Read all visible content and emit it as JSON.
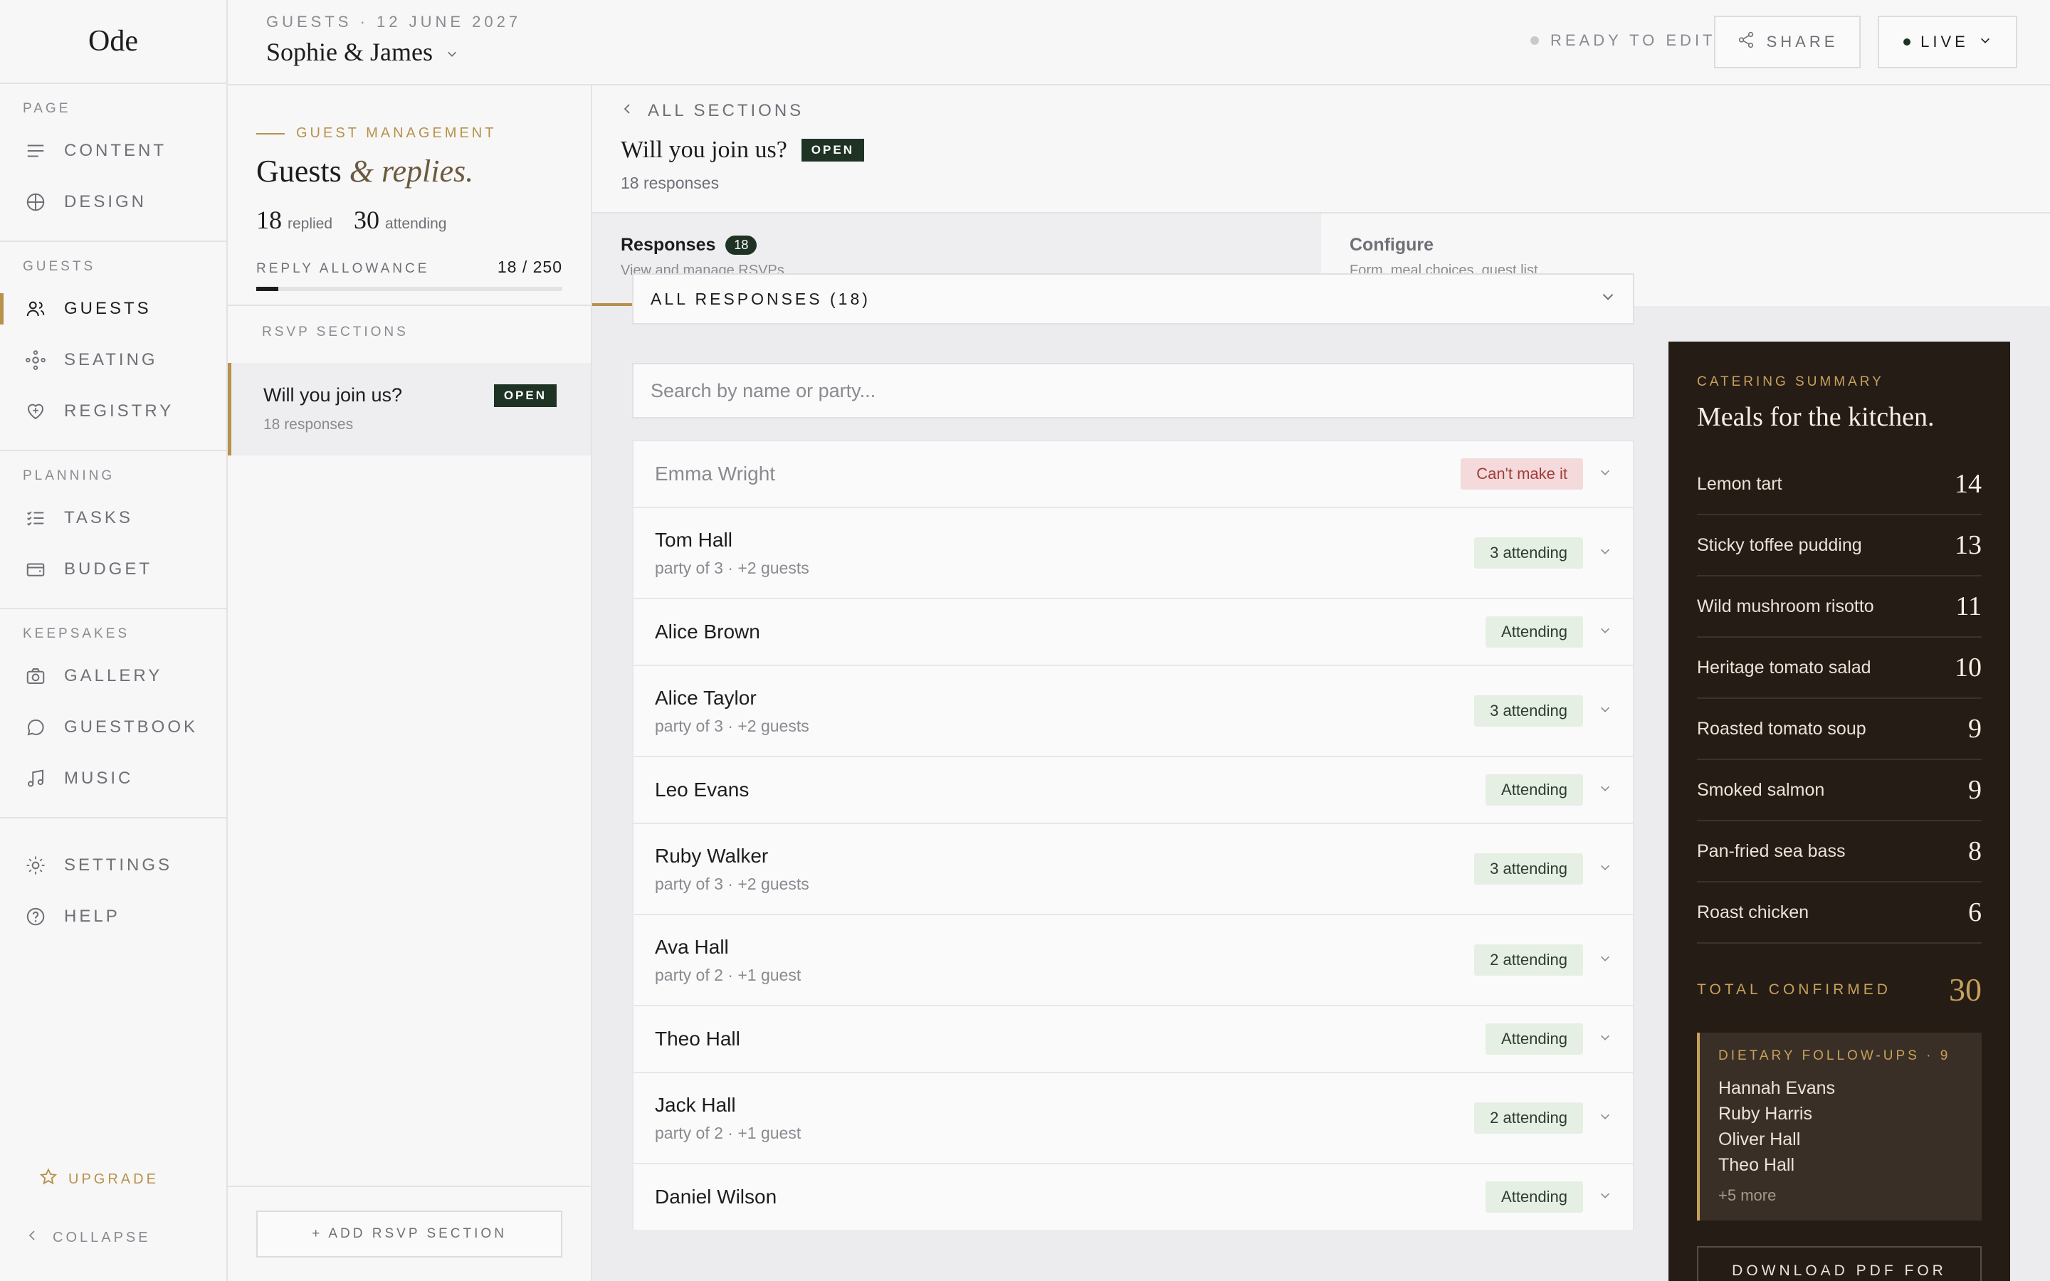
{
  "app": {
    "logo": "Ode"
  },
  "nav": {
    "groups": [
      {
        "title": "Page",
        "items": [
          {
            "label": "Content",
            "icon": "lines-icon"
          },
          {
            "label": "Design",
            "icon": "globe-icon"
          }
        ]
      },
      {
        "title": "Guests",
        "items": [
          {
            "label": "Guests",
            "icon": "people-icon",
            "active": true
          },
          {
            "label": "Seating",
            "icon": "seating-icon"
          },
          {
            "label": "Registry",
            "icon": "heart-gift-icon"
          }
        ]
      },
      {
        "title": "Planning",
        "items": [
          {
            "label": "Tasks",
            "icon": "checklist-icon"
          },
          {
            "label": "Budget",
            "icon": "wallet-icon"
          }
        ]
      },
      {
        "title": "Keepsakes",
        "items": [
          {
            "label": "Gallery",
            "icon": "camera-icon"
          },
          {
            "label": "Guestbook",
            "icon": "chat-bubble-icon"
          },
          {
            "label": "Music",
            "icon": "music-note-icon"
          }
        ]
      }
    ],
    "bottom": [
      {
        "label": "Settings",
        "icon": "sun-gear-icon"
      },
      {
        "label": "Help",
        "icon": "help-circle-icon"
      }
    ],
    "upgrade": "Upgrade",
    "collapse": "Collapse"
  },
  "topbar": {
    "crumb": "Guests · 12 June 2027",
    "couple": "Sophie & James",
    "status": "Ready to edit",
    "share": "Share",
    "live": "Live"
  },
  "guest_panel": {
    "eyebrow": "Guest management",
    "title_a": "Guests",
    "title_amp": "&",
    "title_b": "replies.",
    "replied_num": "18",
    "replied_lbl": "replied",
    "attending_num": "30",
    "attending_lbl": "attending",
    "allowance_lbl": "Reply allowance",
    "allowance_val": "18 / 250",
    "allowance_fraction": 0.072,
    "sections_title": "RSVP sections",
    "section": {
      "name": "Will you join us?",
      "badge": "Open",
      "sub": "18 responses"
    },
    "add_section": "+ Add RSVP section"
  },
  "main": {
    "back": "All sections",
    "question": "Will you join us?",
    "badge": "Open",
    "responses": "18 responses",
    "tabs": [
      {
        "label": "Responses",
        "count": "18",
        "sub": "View and manage RSVPs"
      },
      {
        "label": "Configure",
        "sub": "Form, meal choices, guest list"
      }
    ],
    "filter": "All responses (18)",
    "search_placeholder": "Search by name or party..."
  },
  "responses": [
    {
      "name": "Emma Wright",
      "status": "Can't make it",
      "kind": "cant",
      "party": ""
    },
    {
      "name": "Tom Hall",
      "status": "3 attending",
      "kind": "attending",
      "party": "party of 3 · +2 guests"
    },
    {
      "name": "Alice Brown",
      "status": "Attending",
      "kind": "attending",
      "party": ""
    },
    {
      "name": "Alice Taylor",
      "status": "3 attending",
      "kind": "attending",
      "party": "party of 3 · +2 guests"
    },
    {
      "name": "Leo Evans",
      "status": "Attending",
      "kind": "attending",
      "party": ""
    },
    {
      "name": "Ruby Walker",
      "status": "3 attending",
      "kind": "attending",
      "party": "party of 3 · +2 guests"
    },
    {
      "name": "Ava Hall",
      "status": "2 attending",
      "kind": "attending",
      "party": "party of 2 · +1 guest"
    },
    {
      "name": "Theo Hall",
      "status": "Attending",
      "kind": "attending",
      "party": ""
    },
    {
      "name": "Jack Hall",
      "status": "2 attending",
      "kind": "attending",
      "party": "party of 2 · +1 guest"
    },
    {
      "name": "Daniel Wilson",
      "status": "Attending",
      "kind": "attending",
      "party": ""
    }
  ],
  "catering": {
    "eyebrow": "Catering summary",
    "title": "Meals for the kitchen.",
    "meals": [
      {
        "name": "Lemon tart",
        "count": "14"
      },
      {
        "name": "Sticky toffee pudding",
        "count": "13"
      },
      {
        "name": "Wild mushroom risotto",
        "count": "11"
      },
      {
        "name": "Heritage tomato salad",
        "count": "10"
      },
      {
        "name": "Roasted tomato soup",
        "count": "9"
      },
      {
        "name": "Smoked salmon",
        "count": "9"
      },
      {
        "name": "Pan-fried sea bass",
        "count": "8"
      },
      {
        "name": "Roast chicken",
        "count": "6"
      }
    ],
    "total_lbl": "Total confirmed",
    "total_val": "30",
    "dietary_title": "Dietary follow-ups · 9",
    "dietary_names": [
      "Hannah Evans",
      "Ruby Harris",
      "Oliver Hall",
      "Theo Hall"
    ],
    "dietary_more": "+5 more",
    "download": "Download PDF for"
  },
  "colors": {
    "accent": "#b8914a",
    "dark_green": "#1f3325",
    "panel_dark": "#251c16"
  }
}
